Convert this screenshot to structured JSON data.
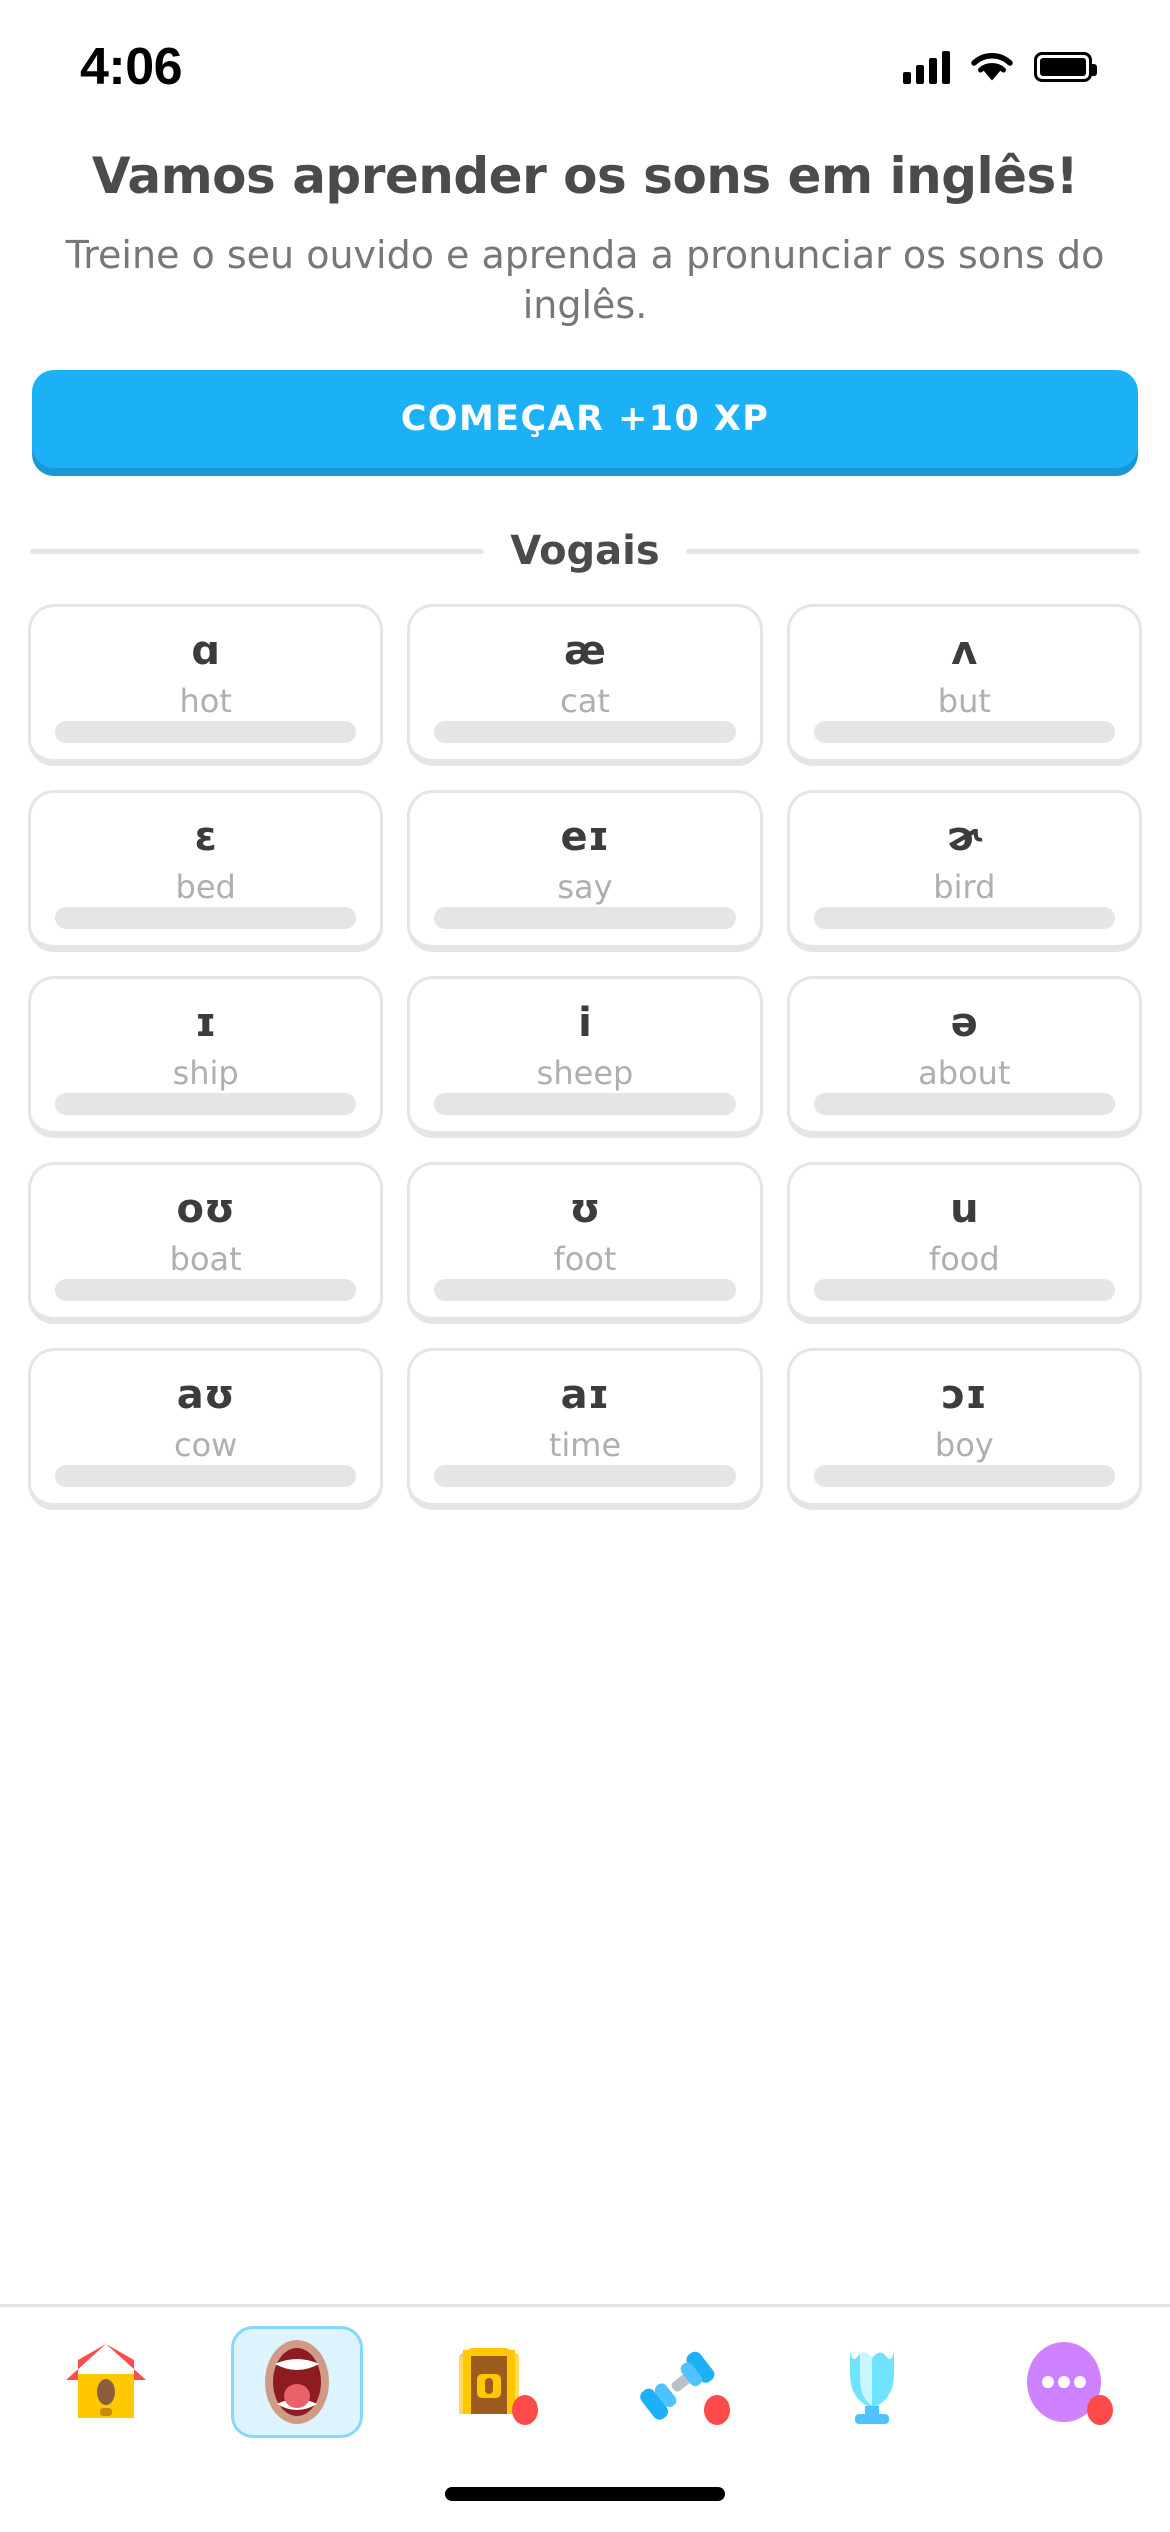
{
  "status_bar": {
    "time": "4:06",
    "signal_icon": "cellular-signal-icon",
    "wifi_icon": "wifi-icon",
    "battery_icon": "battery-full-icon"
  },
  "header": {
    "title": "Vamos aprender os sons em inglês!",
    "subtitle": "Treine o seu ouvido e aprenda a pronunciar os sons do inglês."
  },
  "cta": {
    "label": "COMEÇAR +10 XP",
    "color": "#1CB0F6",
    "shadow_color": "#1899D6"
  },
  "section": {
    "title": "Vogais"
  },
  "phonemes": [
    {
      "symbol": "ɑ",
      "word": "hot",
      "progress": 0
    },
    {
      "symbol": "æ",
      "word": "cat",
      "progress": 0
    },
    {
      "symbol": "ʌ",
      "word": "but",
      "progress": 0
    },
    {
      "symbol": "ɛ",
      "word": "bed",
      "progress": 0
    },
    {
      "symbol": "eɪ",
      "word": "say",
      "progress": 0
    },
    {
      "symbol": "ɚ",
      "word": "bird",
      "progress": 0
    },
    {
      "symbol": "ɪ",
      "word": "ship",
      "progress": 0
    },
    {
      "symbol": "i",
      "word": "sheep",
      "progress": 0
    },
    {
      "symbol": "ə",
      "word": "about",
      "progress": 0
    },
    {
      "symbol": "oʊ",
      "word": "boat",
      "progress": 0
    },
    {
      "symbol": "ʊ",
      "word": "foot",
      "progress": 0
    },
    {
      "symbol": "u",
      "word": "food",
      "progress": 0
    },
    {
      "symbol": "aʊ",
      "word": "cow",
      "progress": 0
    },
    {
      "symbol": "aɪ",
      "word": "time",
      "progress": 0
    },
    {
      "symbol": "ɔɪ",
      "word": "boy",
      "progress": 0
    }
  ],
  "tabs": [
    {
      "name": "home",
      "icon": "house-icon",
      "selected": false,
      "badge": false
    },
    {
      "name": "sounds",
      "icon": "open-mouth-icon",
      "selected": true,
      "badge": false
    },
    {
      "name": "treasure",
      "icon": "treasure-chest-icon",
      "selected": false,
      "badge": true
    },
    {
      "name": "practice",
      "icon": "dumbbell-icon",
      "selected": false,
      "badge": true
    },
    {
      "name": "leagues",
      "icon": "trophy-icon",
      "selected": false,
      "badge": false
    },
    {
      "name": "more",
      "icon": "more-dots-icon",
      "selected": false,
      "badge": true
    }
  ],
  "colors": {
    "accent_blue": "#1CB0F6",
    "text_dark": "#4B4B4B",
    "text_muted": "#777777",
    "card_border": "#E5E5E5",
    "badge_red": "#FF4B4B"
  }
}
